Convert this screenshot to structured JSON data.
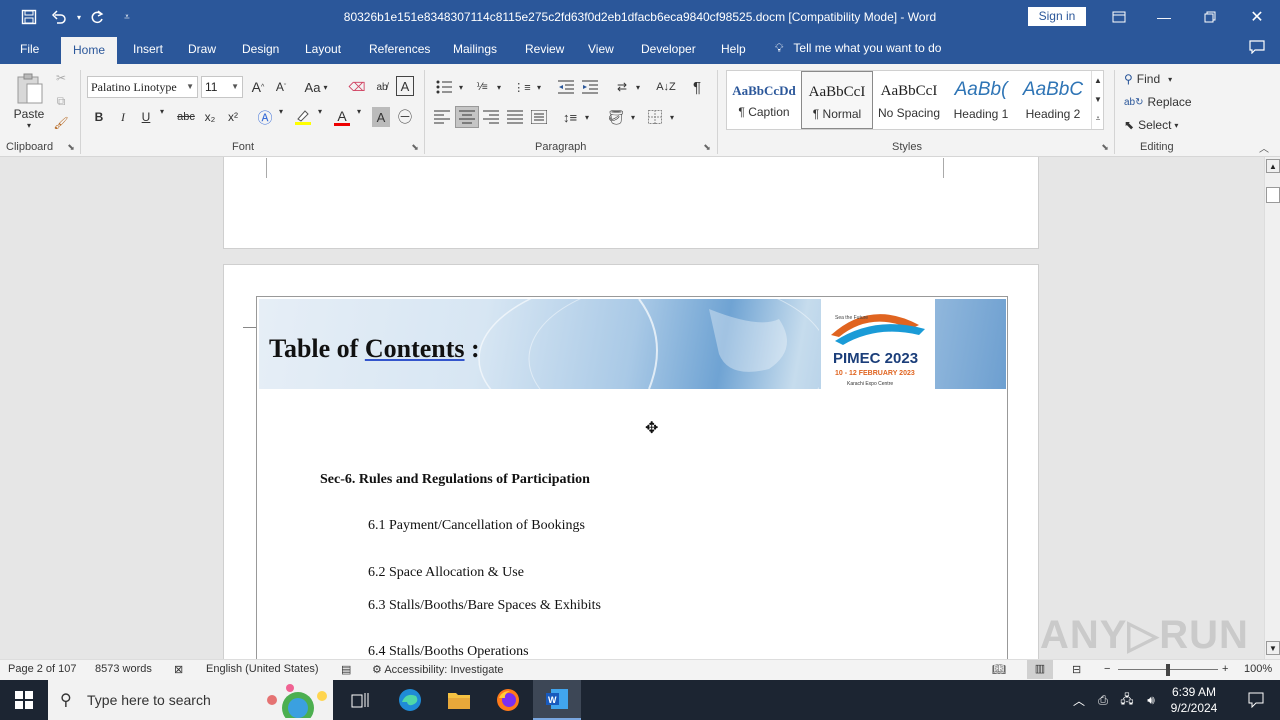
{
  "titlebar": {
    "title": "80326b1e151e8348307114c8115e275c2fd63f0d2eb1dfacb6eca9840cf98525.docm [Compatibility Mode]  -  Word",
    "sign_in": "Sign in"
  },
  "tabs": [
    "File",
    "Home",
    "Insert",
    "Draw",
    "Design",
    "Layout",
    "References",
    "Mailings",
    "Review",
    "View",
    "Developer",
    "Help"
  ],
  "tell_me": "Tell me what you want to do",
  "ribbon": {
    "clipboard": {
      "paste": "Paste",
      "label": "Clipboard"
    },
    "font": {
      "name": "Palatino Linotype",
      "size": "11",
      "label": "Font",
      "bold": "B",
      "italic": "I",
      "underline": "U",
      "strike": "abc",
      "sub": "x₂",
      "sup": "x²",
      "case": "Aa"
    },
    "paragraph": {
      "label": "Paragraph"
    },
    "styles": {
      "label": "Styles",
      "items": [
        {
          "preview": "AaBbCcDd",
          "name": "¶ Caption"
        },
        {
          "preview": "AaBbCcI",
          "name": "¶ Normal"
        },
        {
          "preview": "AaBbCcI",
          "name": "No Spacing"
        },
        {
          "preview": "AaBb(",
          "name": "Heading 1"
        },
        {
          "preview": "AaBbC",
          "name": "Heading 2"
        }
      ]
    },
    "editing": {
      "find": "Find",
      "replace": "Replace",
      "select": "Select",
      "label": "Editing"
    }
  },
  "document": {
    "banner_title_plain": "Table of ",
    "banner_title_link": "Contents",
    "banner_title_end": " :",
    "logo": {
      "tagline": "Sea the Future",
      "name": "PIMEC 2023",
      "dates": "10 - 12 FEBRUARY 2023",
      "venue": "Karachi Expo Centre"
    },
    "section_heading": "Sec-6.  Rules and Regulations of Participation",
    "toc_items": [
      "6.1 Payment/Cancellation of Bookings",
      "6.2 Space Allocation & Use",
      "6.3 Stalls/Booths/Bare Spaces & Exhibits",
      "6.4 Stalls/Booths Operations"
    ]
  },
  "statusbar": {
    "page": "Page 2 of 107",
    "words": "8573 words",
    "language": "English (United States)",
    "accessibility": "Accessibility: Investigate",
    "zoom": "100%"
  },
  "taskbar": {
    "search_placeholder": "Type here to search",
    "time": "6:39 AM",
    "date": "9/2/2024"
  },
  "colors": {
    "word_blue": "#2b579a",
    "taskbar": "#1c2532",
    "ribbon": "#f3f3f3"
  }
}
